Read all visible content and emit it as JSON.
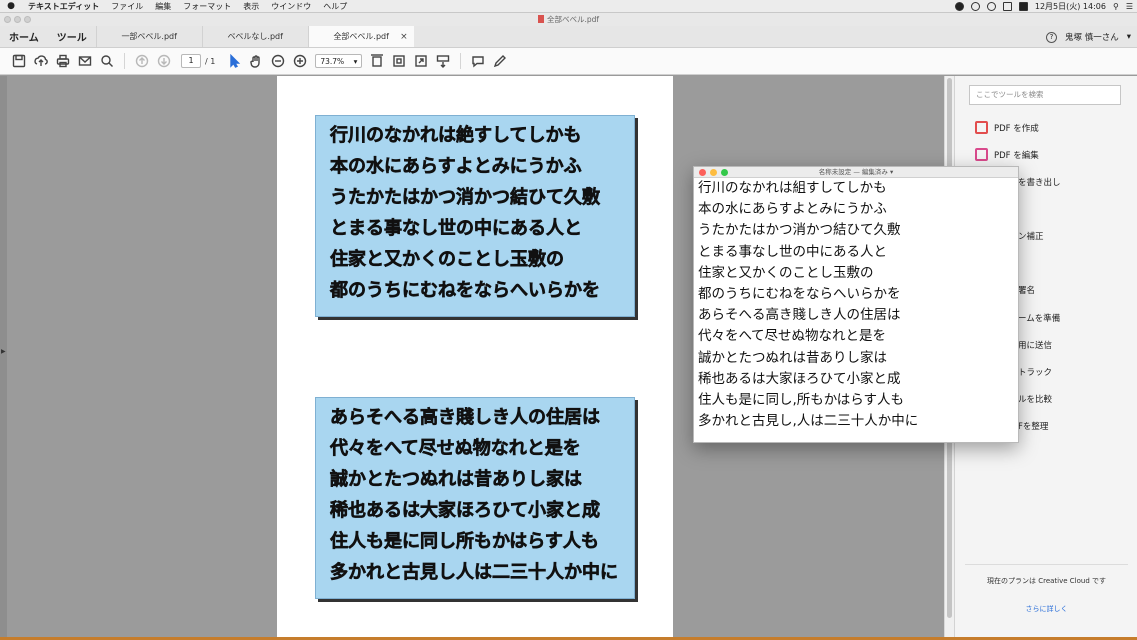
{
  "menubar": {
    "app": "テキストエディット",
    "items": [
      "ファイル",
      "編集",
      "フォーマット",
      "表示",
      "ウインドウ",
      "ヘルプ"
    ],
    "datetime": "12月5日(火) 14:06"
  },
  "window": {
    "title": "全部ベベル.pdf"
  },
  "tabs": {
    "home": "ホーム",
    "tools": "ツール",
    "docs": [
      "一部ベベル.pdf",
      "ベベルなし.pdf",
      "全部ベベル.pdf"
    ],
    "close": "×",
    "user": "鬼塚 慎一さん",
    "user_caret": "▾",
    "help": "?"
  },
  "toolbar": {
    "page_current": "1",
    "page_total": "/ 1",
    "zoom": "73.7%",
    "zoom_caret": "▾"
  },
  "document": {
    "box1": [
      "行川のなかれは絶すしてしかも",
      "本の水にあらすよとみにうかふ",
      "うたかたはかつ消かつ結ひて久敷",
      "とまる事なし世の中にある人と",
      "住家と又かくのことし玉敷の",
      "都のうちにむねをならへいらかを"
    ],
    "box2": [
      "あらそへる高き賤しき人の住居は",
      "代々をへて尽せぬ物なれと是を",
      "誠かとたつぬれは昔ありし家は",
      "稀也あるは大家ほろひて小家と成",
      "住人も是に同し所もかはらす人も",
      "多かれと古見し人は二三十人か中に"
    ]
  },
  "tools_pane": {
    "search_placeholder": "ここでツールを検索",
    "create_pdf": "PDF を作成",
    "edit_pdf": "PDF を編集",
    "partial": [
      "を書き出し",
      "ン補正",
      "署名",
      "ームを準備",
      "用に送信",
      "トラック",
      "ルを比較",
      "Fを整理"
    ],
    "plan": "現在のプランは Creative Cloud です",
    "more": "さらに詳しく"
  },
  "textedit": {
    "title": "名称未設定 — 編集済み ▾",
    "lines": [
      "行川のなかれは組すしてしかも",
      "本の水にあらすよとみにうかふ",
      "うたかたはかつ消かつ結ひて久敷",
      "とまる事なし世の中にある人と",
      "住家と又かくのことし玉敷の",
      "都のうちにむねをならへいらかを",
      "あらそへる高き賤しき人の住居は",
      "代々をへて尽せぬ物なれと是を",
      "誠かとたつぬれは昔ありし家は",
      "稀也あるは大家ほろひて小家と成",
      "住人も是に同し,所もかはらす人も",
      "多かれと古見し,人は二三十人か中に"
    ]
  }
}
